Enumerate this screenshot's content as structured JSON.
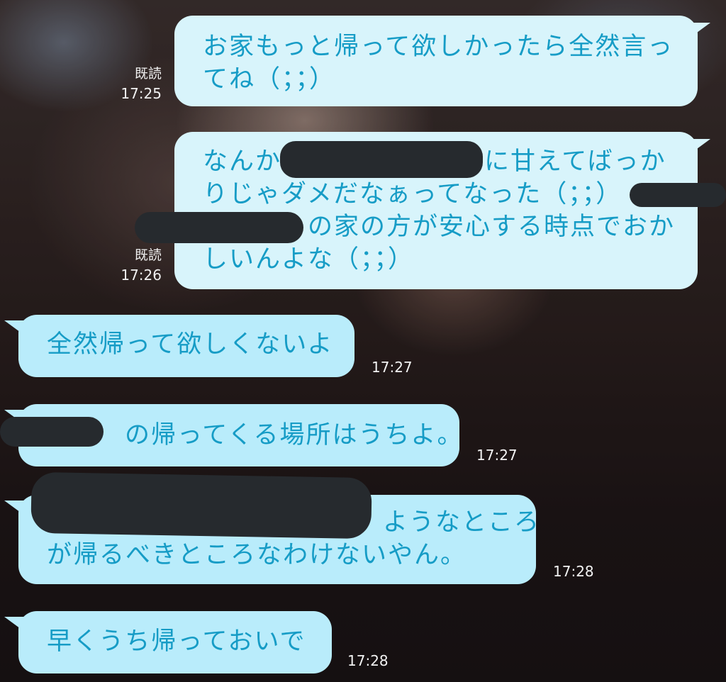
{
  "colors": {
    "outgoing_bubble": "#d8f4fb",
    "incoming_bubble": "#b9ecfb",
    "text": "#169cc6",
    "redaction": "#262a2e"
  },
  "messages": [
    {
      "direction": "outgoing",
      "lines": [
        "お家もっと帰って欲しかったら全然言っ",
        "てね（；；）"
      ],
      "read": "既読",
      "time": "17:25"
    },
    {
      "direction": "outgoing",
      "lines": [
        "なんか",
        "に甘えてばっか",
        "りじゃダメだなぁってなった（；；）",
        "の家の方が安心する時点でおか",
        "しいんよな（；；）"
      ],
      "read": "既読",
      "time": "17:26"
    },
    {
      "direction": "incoming",
      "lines": [
        "全然帰って欲しくないよ"
      ],
      "time": "17:27"
    },
    {
      "direction": "incoming",
      "lines": [
        "の帰ってくる場所はうちよ。"
      ],
      "time": "17:27"
    },
    {
      "direction": "incoming",
      "lines": [
        "ようなところ",
        "が帰るべきところなわけないやん。"
      ],
      "time": "17:28"
    },
    {
      "direction": "incoming",
      "lines": [
        "早くうち帰っておいで"
      ],
      "time": "17:28"
    }
  ]
}
